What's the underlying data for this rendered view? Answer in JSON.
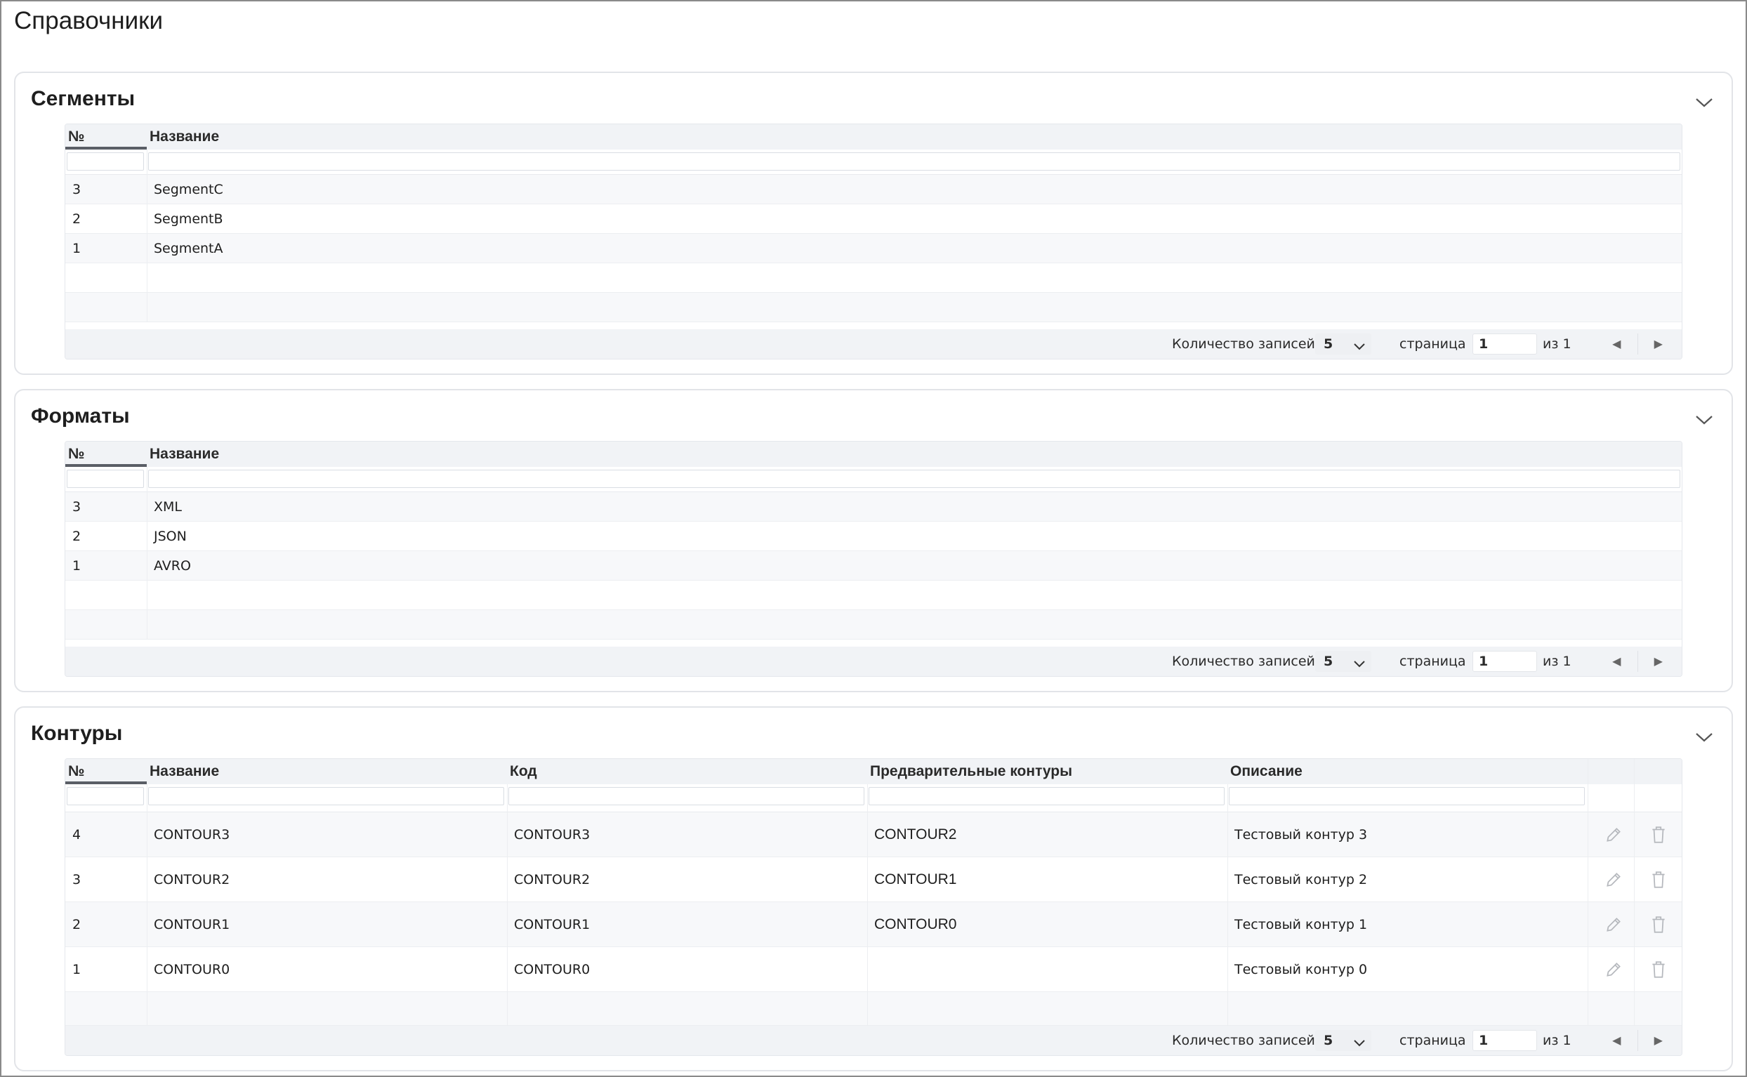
{
  "page": {
    "title": "Справочники"
  },
  "segments": {
    "title": "Сегменты",
    "columns": {
      "num": "№",
      "name": "Название"
    },
    "rows": [
      {
        "num": "3",
        "name": "SegmentC"
      },
      {
        "num": "2",
        "name": "SegmentB"
      },
      {
        "num": "1",
        "name": "SegmentA"
      }
    ],
    "footer": {
      "count_label": "Количество записей",
      "page_size": "5",
      "page_label": "страница",
      "page": "1",
      "of": "из 1"
    }
  },
  "formats": {
    "title": "Форматы",
    "columns": {
      "num": "№",
      "name": "Название"
    },
    "rows": [
      {
        "num": "3",
        "name": "XML"
      },
      {
        "num": "2",
        "name": "JSON"
      },
      {
        "num": "1",
        "name": "AVRO"
      }
    ],
    "footer": {
      "count_label": "Количество записей",
      "page_size": "5",
      "page_label": "страница",
      "page": "1",
      "of": "из 1"
    }
  },
  "contours": {
    "title": "Контуры",
    "columns": {
      "num": "№",
      "name": "Название",
      "code": "Код",
      "prev": "Предварительные контуры",
      "desc": "Описание"
    },
    "rows": [
      {
        "num": "4",
        "name": "CONTOUR3",
        "code": "CONTOUR3",
        "prev": "CONTOUR2",
        "desc": "Тестовый контур 3"
      },
      {
        "num": "3",
        "name": "CONTOUR2",
        "code": "CONTOUR2",
        "prev": "CONTOUR1",
        "desc": "Тестовый контур 2"
      },
      {
        "num": "2",
        "name": "CONTOUR1",
        "code": "CONTOUR1",
        "prev": "CONTOUR0",
        "desc": "Тестовый контур 1"
      },
      {
        "num": "1",
        "name": "CONTOUR0",
        "code": "CONTOUR0",
        "prev": "",
        "desc": "Тестовый контур 0"
      }
    ],
    "footer": {
      "count_label": "Количество записей",
      "page_size": "5",
      "page_label": "страница",
      "page": "1",
      "of": "из 1"
    }
  },
  "icons": {
    "collapse": "chevron-down-icon",
    "edit": "pencil-icon",
    "delete": "trash-icon",
    "prev": "triangle-left-icon",
    "next": "triangle-right-icon"
  },
  "colors": {
    "header_bg": "#f1f3f6",
    "border": "#e2e4e8",
    "accent_underline": "#5a5e66"
  }
}
